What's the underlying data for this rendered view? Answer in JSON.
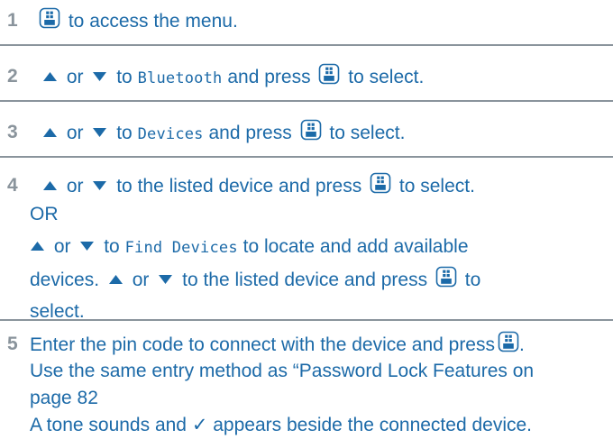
{
  "colors": {
    "text": "#1c6aa8",
    "number": "#8a949c",
    "rule": "#8a949c"
  },
  "icons": {
    "ok_key": "ok-key-icon",
    "up": "arrow-up-icon",
    "down": "arrow-down-icon",
    "check": "checkmark"
  },
  "steps": [
    {
      "num": "1",
      "text_a": "to access the menu."
    },
    {
      "num": "2",
      "or": "or",
      "to": "to",
      "menu": "Bluetooth",
      "and_press": "and press",
      "select": "to select."
    },
    {
      "num": "3",
      "or": "or",
      "to": "to",
      "menu": "Devices",
      "and_press": "and press",
      "select": "to select."
    },
    {
      "num": "4",
      "or": "or",
      "to_listed": "to the listed device and press",
      "select": "to select.",
      "alt": "OR",
      "to": "to",
      "menu": "Find Devices",
      "locate": "to locate and add available",
      "devices": "devices.",
      "to_listed_b": "to the listed device and press",
      "to_b": "to",
      "select_b": "select."
    },
    {
      "num": "5",
      "line1": "Enter the pin code to connect with the device and press",
      "period": ".",
      "line2": "Use the same entry method as “Password Lock Features on",
      "line3": "page 82",
      "line4": "A tone sounds and ✓ appears beside the connected device."
    }
  ]
}
